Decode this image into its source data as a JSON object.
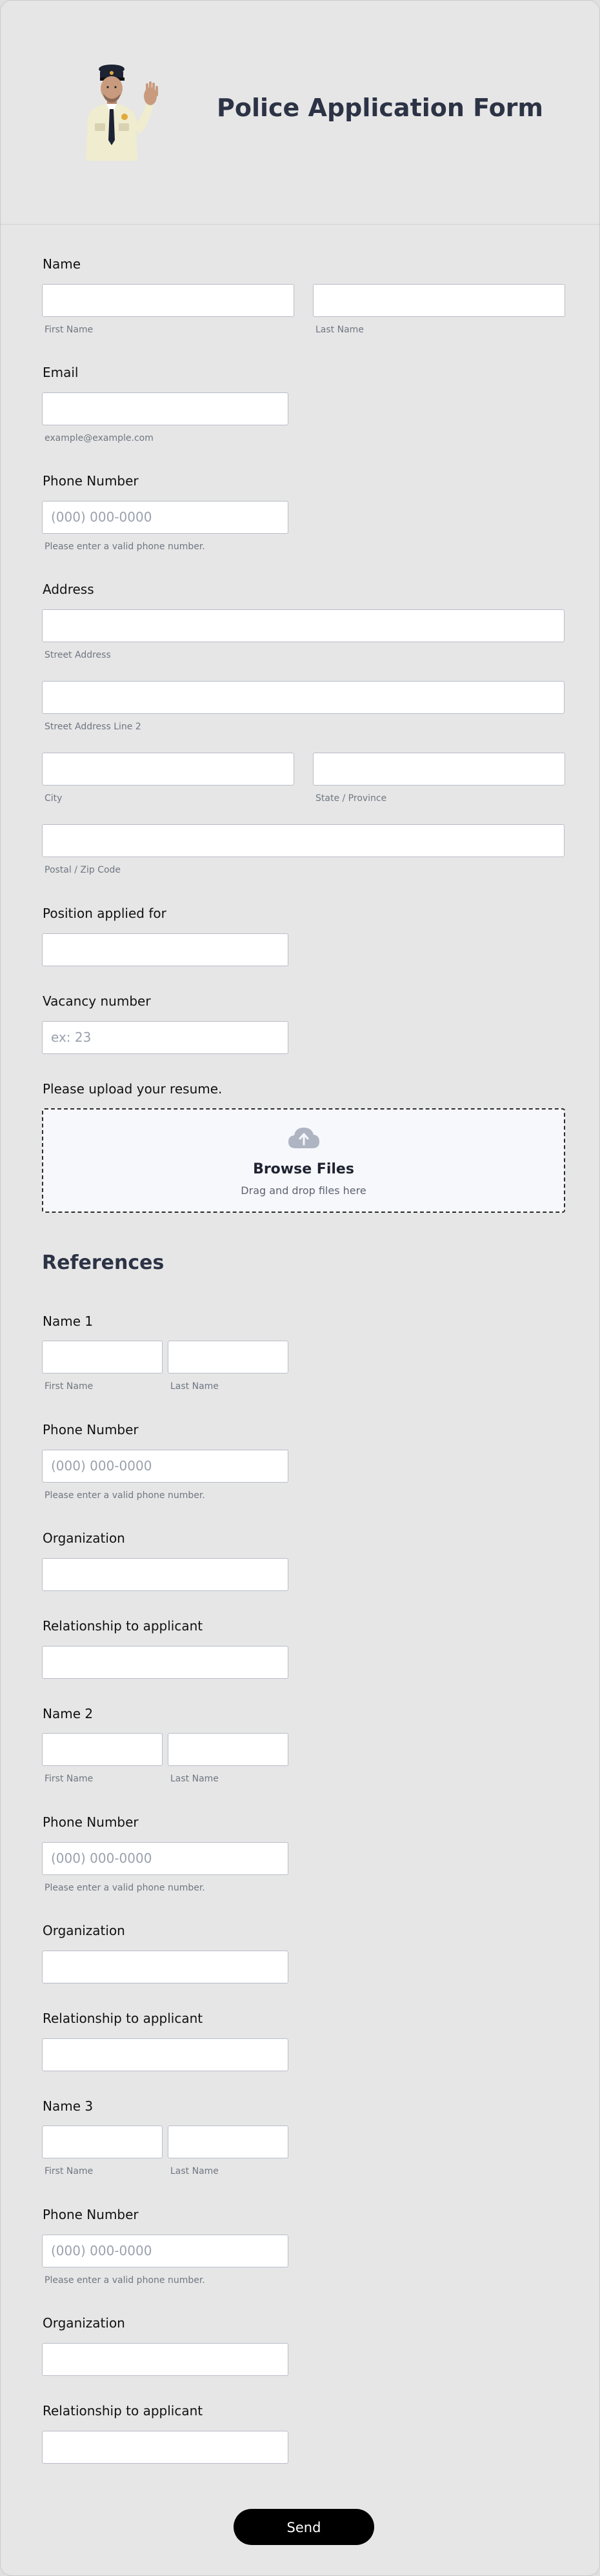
{
  "header": {
    "title": "Police Application Form",
    "illustration": "police-officer-waving"
  },
  "name": {
    "label": "Name",
    "first": "First Name",
    "last": "Last Name"
  },
  "email": {
    "label": "Email",
    "hint": "example@example.com"
  },
  "phone": {
    "label": "Phone Number",
    "placeholder": "(000) 000-0000",
    "hint": "Please enter a valid phone number."
  },
  "address": {
    "label": "Address",
    "street": "Street Address",
    "street2": "Street Address Line 2",
    "city": "City",
    "state": "State / Province",
    "postal": "Postal / Zip Code"
  },
  "position": {
    "label": "Position applied for"
  },
  "vacancy": {
    "label": "Vacancy number",
    "placeholder": "ex: 23"
  },
  "upload": {
    "label": "Please upload your resume.",
    "browse": "Browse Files",
    "drag": "Drag and drop files here",
    "icon": "cloud-upload-icon"
  },
  "references": {
    "title": "References",
    "items": [
      {
        "name_label": "Name 1",
        "first": "First Name",
        "last": "Last Name",
        "phone_label": "Phone Number",
        "phone_placeholder": "(000) 000-0000",
        "phone_hint": "Please enter a valid phone number.",
        "org_label": "Organization",
        "rel_label": "Relationship to applicant"
      },
      {
        "name_label": "Name 2",
        "first": "First Name",
        "last": "Last Name",
        "phone_label": "Phone Number",
        "phone_placeholder": "(000) 000-0000",
        "phone_hint": "Please enter a valid phone number.",
        "org_label": "Organization",
        "rel_label": "Relationship to applicant"
      },
      {
        "name_label": "Name 3",
        "first": "First Name",
        "last": "Last Name",
        "phone_label": "Phone Number",
        "phone_placeholder": "(000) 000-0000",
        "phone_hint": "Please enter a valid phone number.",
        "org_label": "Organization",
        "rel_label": "Relationship to applicant"
      }
    ]
  },
  "submit": {
    "label": "Send"
  },
  "colors": {
    "title": "#2c3345",
    "button": "#000000",
    "background": "#e6e6e6"
  }
}
